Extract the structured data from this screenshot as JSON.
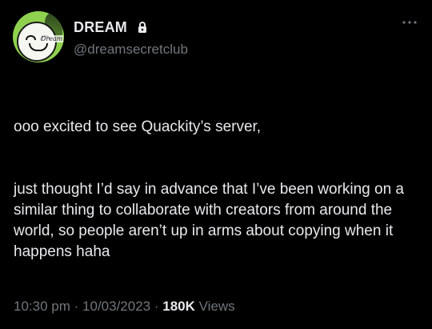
{
  "author": {
    "display_name": "DREAM",
    "handle": "@dreamsecretclub",
    "verified_icon": "lock-icon",
    "avatar_text": "Dream"
  },
  "tweet": {
    "paragraphs": [
      "ooo excited to see Quackity’s server,",
      "just thought I’d say in advance that I’ve been working on a similar thing to collaborate with creators from around the world, so people aren’t up in arms about copying when it happens haha"
    ],
    "time": "10:30 pm",
    "separator": "·",
    "date": "10/03/2023",
    "views_count": "180K",
    "views_label": "Views"
  },
  "colors": {
    "background": "#000000",
    "primary_text": "#e7e9ea",
    "secondary_text": "#71767b"
  },
  "icons": {
    "more": "more-icon",
    "lock": "lock-icon"
  }
}
